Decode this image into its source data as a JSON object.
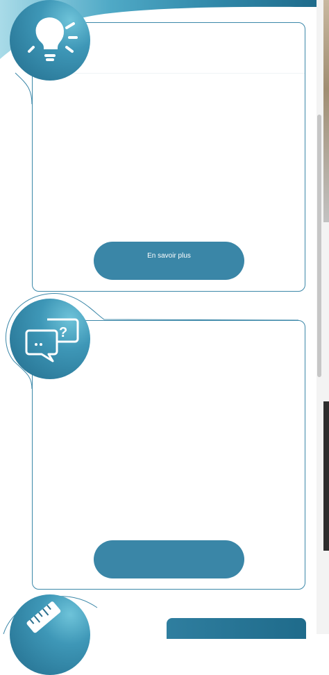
{
  "page": {
    "accent_color": "#3a86a7",
    "accent_dark": "#2b6f8e",
    "border_color": "#3b87a8"
  },
  "cards": [
    {
      "icon": "lightbulb-icon",
      "button_label": "En savoir plus"
    },
    {
      "icon": "chat-bubbles-question-icon",
      "button_label": ""
    },
    {
      "icon": "ruler-icon"
    }
  ]
}
